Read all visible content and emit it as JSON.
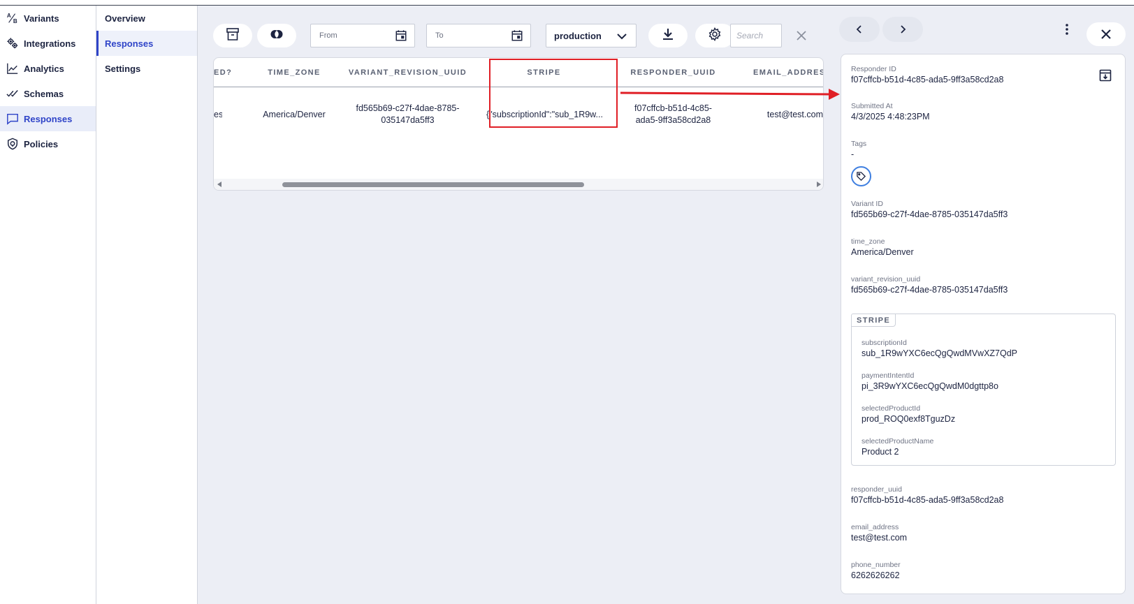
{
  "colors": {
    "accent": "#2f44c8",
    "highlight": "#e01f26",
    "tag_ring": "#3f7fe0"
  },
  "nav_primary": [
    {
      "label": "Variants",
      "icon": "ab-test-icon",
      "active": false
    },
    {
      "label": "Integrations",
      "icon": "gears-icon",
      "active": false
    },
    {
      "label": "Analytics",
      "icon": "line-chart-icon",
      "active": false
    },
    {
      "label": "Schemas",
      "icon": "double-check-icon",
      "active": false
    },
    {
      "label": "Responses",
      "icon": "chat-bubble-icon",
      "active": true
    },
    {
      "label": "Policies",
      "icon": "shield-icon",
      "active": false
    }
  ],
  "nav_secondary": [
    {
      "label": "Overview",
      "active": false
    },
    {
      "label": "Responses",
      "active": true
    },
    {
      "label": "Settings",
      "active": false
    }
  ],
  "toolbar": {
    "from_placeholder": "From",
    "to_placeholder": "To",
    "environment": "production",
    "search_placeholder": "Search"
  },
  "table": {
    "columns": [
      "ED?",
      "TIME_ZONE",
      "VARIANT_REVISION_UUID",
      "STRIPE",
      "RESPONDER_UUID",
      "EMAIL_ADDRESS"
    ],
    "rows": [
      [
        "es",
        "America/Denver",
        "fd565b69-c27f-4dae-8785-\n035147da5ff3",
        "{\"subscriptionId\":\"sub_1R9w...",
        "f07cffcb-b51d-4c85-\nada5-9ff3a58cd2a8",
        "test@test.com"
      ]
    ]
  },
  "detail": {
    "responder_id_label": "Responder ID",
    "responder_id": "f07cffcb-b51d-4c85-ada5-9ff3a58cd2a8",
    "submitted_at_label": "Submitted At",
    "submitted_at": "4/3/2025 4:48:23PM",
    "tags_label": "Tags",
    "tags_value": "-",
    "variant_id_label": "Variant ID",
    "variant_id": "fd565b69-c27f-4dae-8785-035147da5ff3",
    "time_zone_label": "time_zone",
    "time_zone": "America/Denver",
    "variant_revision_uuid_label": "variant_revision_uuid",
    "variant_revision_uuid": "fd565b69-c27f-4dae-8785-035147da5ff3",
    "stripe": {
      "title": "STRIPE",
      "subscription_id_label": "subscriptionId",
      "subscription_id": "sub_1R9wYXC6ecQgQwdMVwXZ7QdP",
      "payment_intent_id_label": "paymentIntentId",
      "payment_intent_id": "pi_3R9wYXC6ecQgQwdM0dgttp8o",
      "selected_product_id_label": "selectedProductId",
      "selected_product_id": "prod_ROQ0exf8TguzDz",
      "selected_product_name_label": "selectedProductName",
      "selected_product_name": "Product 2"
    },
    "responder_uuid_label": "responder_uuid",
    "responder_uuid": "f07cffcb-b51d-4c85-ada5-9ff3a58cd2a8",
    "email_address_label": "email_address",
    "email_address": "test@test.com",
    "phone_number_label": "phone_number",
    "phone_number": "6262626262"
  }
}
